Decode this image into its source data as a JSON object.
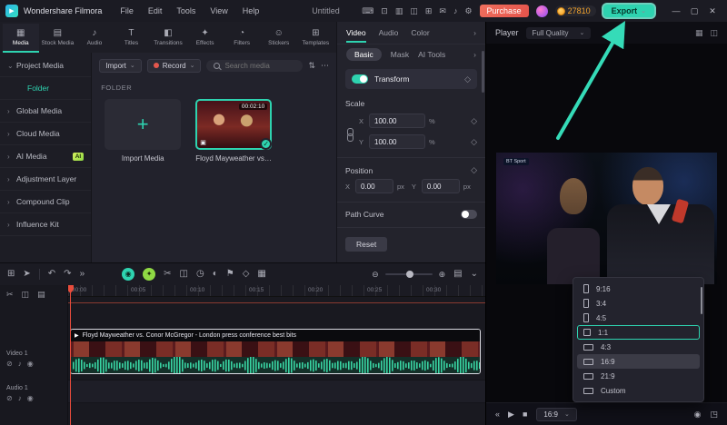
{
  "glyphs": {
    "logo": "▶",
    "caret_down": "⌄",
    "more": "⋯",
    "filter": "⇅",
    "chev_right": "›",
    "plus": "+",
    "check": "✓",
    "diamond": "◇",
    "play": "▶",
    "clip_badge": "▣"
  },
  "titlebar": {
    "app_name": "Wondershare Filmora",
    "menus": [
      "File",
      "Edit",
      "Tools",
      "View",
      "Help"
    ],
    "project_name": "Untitled",
    "tool_icons": [
      {
        "glyph": "⌨"
      },
      {
        "glyph": "⊡"
      },
      {
        "glyph": "▥"
      },
      {
        "glyph": "◫"
      },
      {
        "glyph": "⊞"
      },
      {
        "glyph": "✉"
      },
      {
        "glyph": "♪"
      },
      {
        "glyph": "⚙"
      }
    ],
    "purchase_label": "Purchase",
    "coin_count": "27810",
    "export_label": "Export",
    "window_controls": [
      {
        "glyph": "—"
      },
      {
        "glyph": "▢"
      },
      {
        "glyph": "✕"
      }
    ]
  },
  "media_tabs": [
    {
      "icon": "▦",
      "label": "Media",
      "state": "active"
    },
    {
      "icon": "▤",
      "label": "Stock Media"
    },
    {
      "icon": "♪",
      "label": "Audio"
    },
    {
      "icon": "T",
      "label": "Titles"
    },
    {
      "icon": "◧",
      "label": "Transitions"
    },
    {
      "icon": "✦",
      "label": "Effects"
    },
    {
      "icon": "◔",
      "label": "Filters"
    },
    {
      "icon": "☺",
      "label": "Stickers"
    },
    {
      "icon": "⊞",
      "label": "Templates"
    }
  ],
  "sidebar": {
    "items": [
      {
        "chevron": "⌄",
        "label": "Project Media"
      },
      {
        "label": "Folder",
        "state": "selected"
      },
      {
        "chevron": "›",
        "label": "Global Media"
      },
      {
        "chevron": "›",
        "label": "Cloud Media"
      },
      {
        "chevron": "›",
        "label": "AI Media",
        "badge": "AI"
      },
      {
        "chevron": "›",
        "label": "Adjustment Layer"
      },
      {
        "chevron": "›",
        "label": "Compound Clip"
      },
      {
        "chevron": "›",
        "label": "Influence Kit"
      }
    ]
  },
  "media_panel": {
    "import_label": "Import",
    "record_label": "Record",
    "search_placeholder": "Search media",
    "folder_heading": "FOLDER",
    "import_tile_label": "Import Media",
    "clip_title": "Floyd Mayweather vs. ...",
    "clip_duration": "00:02:10"
  },
  "props": {
    "tabs": [
      {
        "label": "Video",
        "state": "active"
      },
      {
        "label": "Audio"
      },
      {
        "label": "Color"
      }
    ],
    "subtabs": [
      {
        "label": "Basic",
        "state": "active"
      },
      {
        "label": "Mask"
      },
      {
        "label": "AI Tools"
      }
    ],
    "transform_label": "Transform",
    "scale": {
      "label": "Scale",
      "x_label": "X",
      "x_value": "100.00",
      "y_label": "Y",
      "y_value": "100.00",
      "unit": "%"
    },
    "position": {
      "label": "Position",
      "x_label": "X",
      "x_value": "0.00",
      "y_label": "Y",
      "y_value": "0.00",
      "unit": "px"
    },
    "path_curve_label": "Path Curve",
    "reset_label": "Reset"
  },
  "player": {
    "label": "Player",
    "quality": "Full Quality",
    "header_icons": [
      {
        "glyph": "▦"
      },
      {
        "glyph": "◫"
      }
    ],
    "preview_badge": "BT Sport",
    "aspect_button": "16:9",
    "controls_left": [
      {
        "glyph": "«"
      },
      {
        "glyph": "▶"
      },
      {
        "glyph": "■"
      }
    ],
    "controls_right": [
      {
        "glyph": "◉"
      },
      {
        "glyph": "◳"
      }
    ],
    "aspect_options": [
      {
        "icon": "ic-portrait",
        "label": "9:16"
      },
      {
        "icon": "ic-portrait",
        "label": "3:4"
      },
      {
        "icon": "ic-portrait",
        "label": "4:5"
      },
      {
        "icon": "ic-square",
        "label": "1:1",
        "state": "selected"
      },
      {
        "icon": "ic-land",
        "label": "4:3"
      },
      {
        "icon": "ic-land",
        "label": "16:9",
        "state": "hover"
      },
      {
        "icon": "ic-land",
        "label": "21:9"
      },
      {
        "icon": "ic-land",
        "label": "Custom"
      }
    ]
  },
  "timeline": {
    "tools_primary": [
      {
        "glyph": "⊞"
      },
      {
        "glyph": "➤"
      }
    ],
    "tools_history": [
      {
        "glyph": "↶"
      },
      {
        "glyph": "↷"
      },
      {
        "glyph": "»"
      }
    ],
    "tools_edit": [
      {
        "glyph": "◉",
        "state": "accent-teal"
      },
      {
        "glyph": "✦",
        "state": "accent-green"
      },
      {
        "glyph": "✂"
      },
      {
        "glyph": "◫"
      },
      {
        "glyph": "◷"
      },
      {
        "glyph": "◐"
      },
      {
        "glyph": "⚑"
      },
      {
        "glyph": "◇"
      },
      {
        "glyph": "▦"
      }
    ],
    "zoom_out": "⊖",
    "zoom_in": "⊕",
    "tools_right": [
      {
        "glyph": "▤"
      },
      {
        "glyph": "⌄"
      }
    ],
    "track_tools": [
      {
        "glyph": "✂"
      },
      {
        "glyph": "◫"
      },
      {
        "glyph": "▤"
      }
    ],
    "ruler": [
      "00:00",
      "00:05",
      "00:10",
      "00:15",
      "00:20",
      "00:25",
      "00:30"
    ],
    "video_track_label": "Video 1",
    "audio_track_label": "Audio 1",
    "track_icons": [
      {
        "glyph": "⊘"
      },
      {
        "glyph": "♪"
      },
      {
        "glyph": "◉"
      }
    ],
    "clip_title": "Floyd Mayweather vs. Conor McGregor - London press conference best bits"
  }
}
